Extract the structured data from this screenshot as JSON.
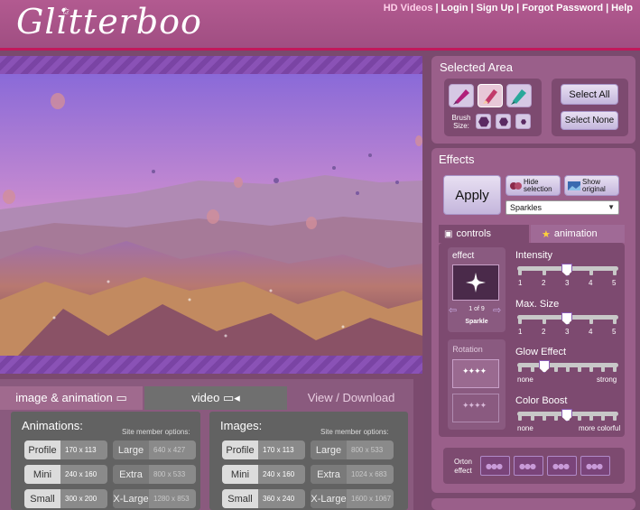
{
  "header": {
    "logo": "Glitterboo",
    "links": [
      "HD Videos",
      "Login",
      "Sign Up",
      "Forgot Password",
      "Help"
    ]
  },
  "colors": {
    "brand": "#b25a90",
    "accent_line": "#d22b6e",
    "panel": "#9a5f8a",
    "tab_active": "#6f6f6f"
  },
  "photo": {
    "subject": "hot-air balloons over rocky valley at sunset"
  },
  "bottom_tabs": [
    {
      "label": "image & animation",
      "icon": "image-icon"
    },
    {
      "label": "video",
      "icon": "video-camera-icon"
    },
    {
      "label": "View / Download"
    }
  ],
  "animations": {
    "title": "Animations:",
    "member_note": "Site member options:",
    "sizes": [
      {
        "label": "Profile",
        "dim": "170 x 113"
      },
      {
        "label": "Mini",
        "dim": "240 x 160"
      },
      {
        "label": "Small",
        "dim": "300 x 200"
      }
    ],
    "member_sizes": [
      {
        "label": "Large",
        "dim": "640 x 427"
      },
      {
        "label": "Extra",
        "dim": "800 x 533"
      },
      {
        "label": "X-Large",
        "dim": "1280 x 853"
      }
    ]
  },
  "images": {
    "title": "Images:",
    "member_note": "Site member options:",
    "sizes": [
      {
        "label": "Profile",
        "dim": "170 x 113"
      },
      {
        "label": "Mini",
        "dim": "240 x 160"
      },
      {
        "label": "Small",
        "dim": "360 x 240"
      }
    ],
    "member_sizes": [
      {
        "label": "Large",
        "dim": "800 x 533"
      },
      {
        "label": "Extra",
        "dim": "1024 x 683"
      },
      {
        "label": "X-Large",
        "dim": "1600 x 1067"
      }
    ]
  },
  "selected_area": {
    "title": "Selected Area",
    "brush_label_1": "Brush",
    "brush_label_2": "Size:",
    "tools": [
      "brush-icon",
      "eraser-icon",
      "fill-icon"
    ],
    "select_all": "Select All",
    "select_none": "Select None"
  },
  "effects": {
    "title": "Effects",
    "apply": "Apply",
    "hide_selection_1": "Hide",
    "hide_selection_2": "selection",
    "show_original_1": "Show",
    "show_original_2": "original",
    "effect_select": "Sparkles"
  },
  "controls": {
    "tab_controls": "controls",
    "tab_animation": "animation",
    "effect_label": "effect",
    "effect_pager": "1 of 9",
    "effect_name": "Sparkle",
    "rotation_label": "Rotation",
    "intensity": {
      "label": "Intensity",
      "ticks": [
        "1",
        "2",
        "3",
        "4",
        "5"
      ],
      "value": 3
    },
    "max_size": {
      "label": "Max. Size",
      "ticks": [
        "1",
        "2",
        "3",
        "4",
        "5"
      ],
      "value": 3
    },
    "glow": {
      "label": "Glow Effect",
      "min": "none",
      "max": "strong",
      "value": 0.25
    },
    "color_boost": {
      "label": "Color Boost",
      "min": "none",
      "max": "more colorful",
      "value": 0.5
    },
    "orton_1": "Orton",
    "orton_2": "effect"
  }
}
